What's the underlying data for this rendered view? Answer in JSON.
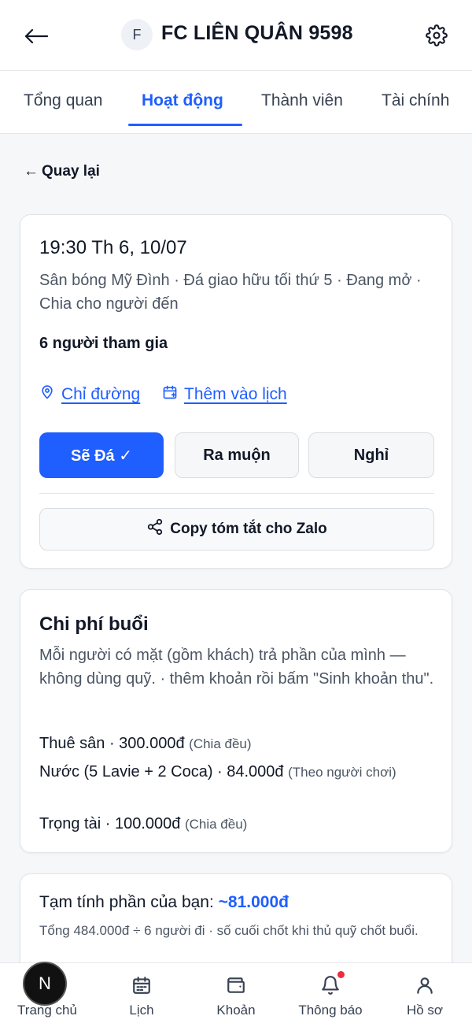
{
  "header": {
    "avatar_letter": "F",
    "team_name": "FC LIÊN QUÂN 9598"
  },
  "tabs": [
    {
      "label": "Tổng quan",
      "active": false
    },
    {
      "label": "Hoạt động",
      "active": true
    },
    {
      "label": "Thành viên",
      "active": false
    },
    {
      "label": "Tài chính",
      "active": false
    }
  ],
  "back_label": "Quay lại",
  "event": {
    "time": "19:30 Th 6, 10/07",
    "subtitle": "Sân bóng Mỹ Đình · Đá giao hữu tối thứ 5 · Đang mở · Chia cho người đến",
    "participants": "6 người tham gia",
    "directions_label": "Chỉ đường",
    "calendar_label": "Thêm vào lịch",
    "rsvp": {
      "going": "Sẽ Đá ✓",
      "late": "Ra muộn",
      "off": "Nghỉ"
    },
    "copy_label": "Copy tóm tắt cho Zalo"
  },
  "costs": {
    "title": "Chi phí buổi",
    "description": "Mỗi người có mặt (gồm khách) trả phần của mình — không dùng quỹ. · thêm khoản rồi bấm \"Sinh khoản thu\".",
    "items": [
      {
        "text": "Thuê sân · 300.000đ",
        "note": "(Chia đều)"
      },
      {
        "text": "Nước (5 Lavie + 2 Coca) · 84.000đ",
        "note": "(Theo người chơi)"
      },
      {
        "text": "Trọng tài · 100.000đ",
        "note": "(Chia đều)"
      }
    ]
  },
  "estimate": {
    "label": "Tạm tính phần của bạn:",
    "amount": "~81.000đ",
    "note": "Tổng 484.000đ ÷ 6 người đi · số cuối chốt khi thủ quỹ chốt buổi."
  },
  "nav": {
    "badge_letter": "N",
    "items": [
      {
        "label": "Trang chủ",
        "icon": "home-icon"
      },
      {
        "label": "Lịch",
        "icon": "calendar-icon"
      },
      {
        "label": "Khoản",
        "icon": "wallet-icon"
      },
      {
        "label": "Thông báo",
        "icon": "bell-icon"
      },
      {
        "label": "Hồ sơ",
        "icon": "user-icon"
      }
    ]
  },
  "colors": {
    "accent": "#1f5eff",
    "notification_dot": "#ef2b3c"
  }
}
